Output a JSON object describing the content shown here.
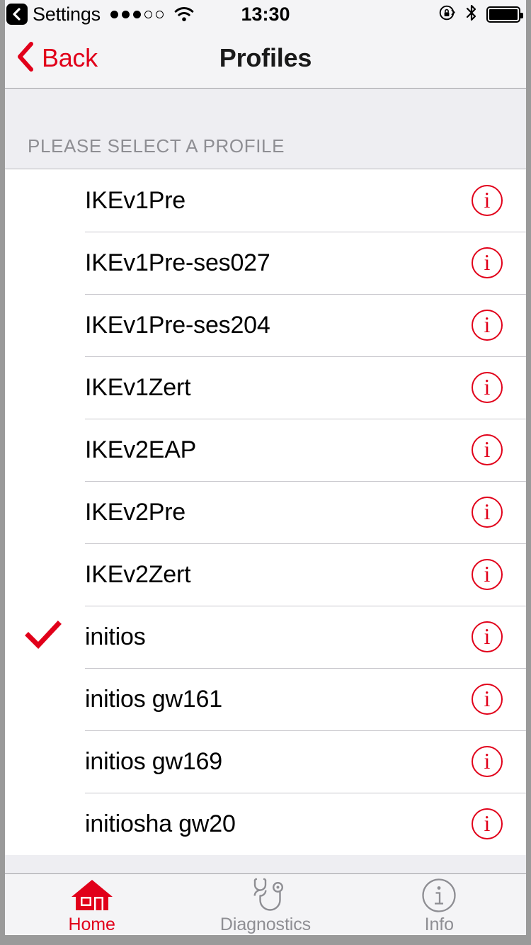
{
  "theme": {
    "accent": "#e1001a",
    "nav_bg": "#f4f4f6",
    "section_bg": "#eeeef2",
    "separator": "#c8c7cc",
    "inactive": "#8e8e93",
    "frame": "#9a9a9a"
  },
  "status_bar": {
    "back_app": "Settings",
    "back_badge_icon": "chevron-left-icon",
    "signal_dots": {
      "filled": 3,
      "empty": 2
    },
    "wifi_icon": "wifi-icon",
    "time": "13:30",
    "rotation_lock_icon": "rotation-lock-icon",
    "bluetooth_icon": "bluetooth-icon",
    "battery_icon": "battery-full-icon",
    "battery_level": 100
  },
  "nav_bar": {
    "back_label": "Back",
    "back_icon": "chevron-left-icon",
    "title": "Profiles"
  },
  "section": {
    "header": "PLEASE SELECT A PROFILE"
  },
  "profiles": [
    {
      "label": "IKEv1Pre",
      "selected": false
    },
    {
      "label": "IKEv1Pre-ses027",
      "selected": false
    },
    {
      "label": "IKEv1Pre-ses204",
      "selected": false
    },
    {
      "label": "IKEv1Zert",
      "selected": false
    },
    {
      "label": "IKEv2EAP",
      "selected": false
    },
    {
      "label": "IKEv2Pre",
      "selected": false
    },
    {
      "label": "IKEv2Zert",
      "selected": false
    },
    {
      "label": "initios",
      "selected": true
    },
    {
      "label": "initios gw161",
      "selected": false
    },
    {
      "label": "initios gw169",
      "selected": false
    },
    {
      "label": "initiosha gw20",
      "selected": false
    }
  ],
  "row_accessory": {
    "info_icon": "info-circle-icon",
    "info_glyph": "i",
    "check_icon": "checkmark-icon"
  },
  "tab_bar": {
    "tabs": [
      {
        "label": "Home",
        "icon": "home-icon",
        "active": true
      },
      {
        "label": "Diagnostics",
        "icon": "stethoscope-icon",
        "active": false
      },
      {
        "label": "Info",
        "icon": "info-circle-icon",
        "active": false
      }
    ]
  }
}
